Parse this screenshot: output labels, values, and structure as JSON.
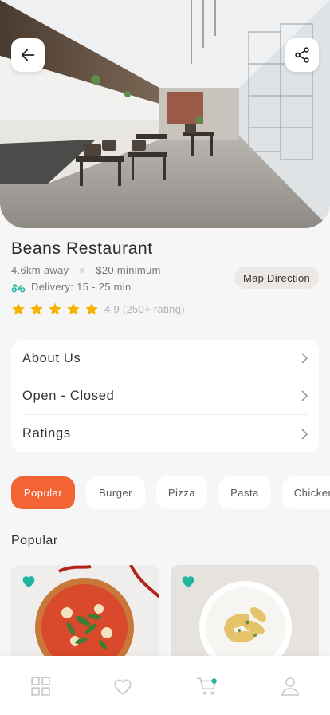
{
  "restaurant": {
    "name": "Beans Restaurant",
    "distance": "4.6km away",
    "minimum": "$20 minimum",
    "delivery": "Delivery: 15 - 25 min",
    "rating": 4.9,
    "rating_text": "4.9 (250+ rating)",
    "stars": 5
  },
  "buttons": {
    "map_direction": "Map Direction",
    "back_icon": "arrow-left-icon",
    "share_icon": "share-icon"
  },
  "info_rows": [
    {
      "label": "About Us"
    },
    {
      "label": "Open - Closed"
    },
    {
      "label": "Ratings"
    }
  ],
  "categories": [
    {
      "label": "Popular",
      "active": true
    },
    {
      "label": "Burger",
      "active": false
    },
    {
      "label": "Pizza",
      "active": false
    },
    {
      "label": "Pasta",
      "active": false
    },
    {
      "label": "Chicken",
      "active": false
    }
  ],
  "section": {
    "title": "Popular"
  },
  "foods": [
    {
      "name": "pizza",
      "favorited": true
    },
    {
      "name": "pasta",
      "favorited": true
    }
  ],
  "tabs": [
    {
      "icon": "grid-icon",
      "active": false
    },
    {
      "icon": "heart-icon",
      "active": false
    },
    {
      "icon": "cart-icon",
      "active": true
    },
    {
      "icon": "user-icon",
      "active": false
    }
  ],
  "colors": {
    "accent": "#f26434",
    "star": "#f5b400",
    "teal": "#1fb5a0",
    "background": "#f6f6f6"
  }
}
